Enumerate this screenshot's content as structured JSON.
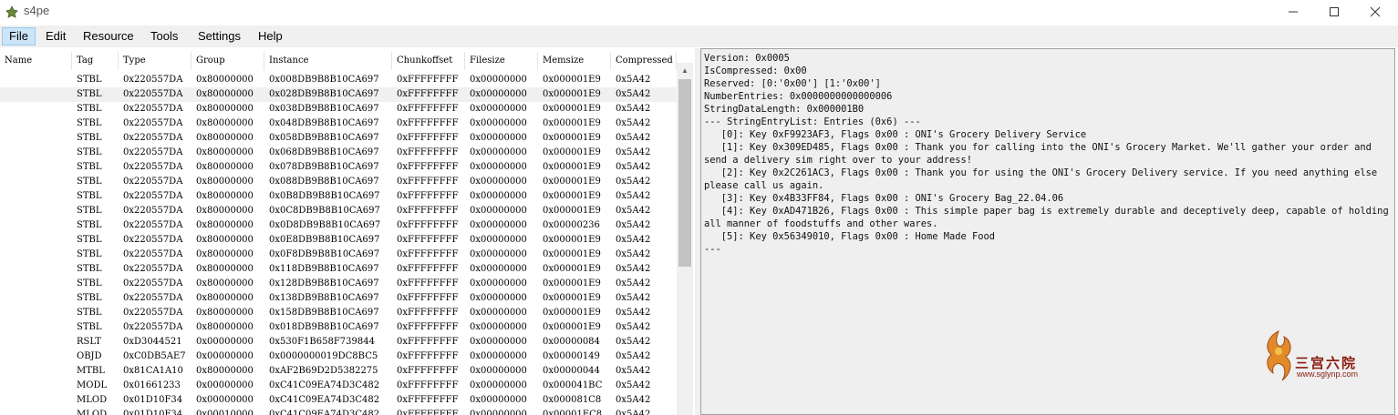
{
  "window": {
    "title": "s4pe"
  },
  "menu": [
    "File",
    "Edit",
    "Resource",
    "Tools",
    "Settings",
    "Help"
  ],
  "columns": [
    "Name",
    "Tag",
    "Type",
    "Group",
    "Instance",
    "Chunkoffset",
    "Filesize",
    "Memsize",
    "Compressed"
  ],
  "rows": [
    [
      "",
      "STBL",
      "0x220557DA",
      "0x80000000",
      "0x008DB9B8B10CA697",
      "0xFFFFFFFF",
      "0x00000000",
      "0x000001E9",
      "0x5A42"
    ],
    [
      "",
      "STBL",
      "0x220557DA",
      "0x80000000",
      "0x028DB9B8B10CA697",
      "0xFFFFFFFF",
      "0x00000000",
      "0x000001E9",
      "0x5A42"
    ],
    [
      "",
      "STBL",
      "0x220557DA",
      "0x80000000",
      "0x038DB9B8B10CA697",
      "0xFFFFFFFF",
      "0x00000000",
      "0x000001E9",
      "0x5A42"
    ],
    [
      "",
      "STBL",
      "0x220557DA",
      "0x80000000",
      "0x048DB9B8B10CA697",
      "0xFFFFFFFF",
      "0x00000000",
      "0x000001E9",
      "0x5A42"
    ],
    [
      "",
      "STBL",
      "0x220557DA",
      "0x80000000",
      "0x058DB9B8B10CA697",
      "0xFFFFFFFF",
      "0x00000000",
      "0x000001E9",
      "0x5A42"
    ],
    [
      "",
      "STBL",
      "0x220557DA",
      "0x80000000",
      "0x068DB9B8B10CA697",
      "0xFFFFFFFF",
      "0x00000000",
      "0x000001E9",
      "0x5A42"
    ],
    [
      "",
      "STBL",
      "0x220557DA",
      "0x80000000",
      "0x078DB9B8B10CA697",
      "0xFFFFFFFF",
      "0x00000000",
      "0x000001E9",
      "0x5A42"
    ],
    [
      "",
      "STBL",
      "0x220557DA",
      "0x80000000",
      "0x088DB9B8B10CA697",
      "0xFFFFFFFF",
      "0x00000000",
      "0x000001E9",
      "0x5A42"
    ],
    [
      "",
      "STBL",
      "0x220557DA",
      "0x80000000",
      "0x0B8DB9B8B10CA697",
      "0xFFFFFFFF",
      "0x00000000",
      "0x000001E9",
      "0x5A42"
    ],
    [
      "",
      "STBL",
      "0x220557DA",
      "0x80000000",
      "0x0C8DB9B8B10CA697",
      "0xFFFFFFFF",
      "0x00000000",
      "0x000001E9",
      "0x5A42"
    ],
    [
      "",
      "STBL",
      "0x220557DA",
      "0x80000000",
      "0x0D8DB9B8B10CA697",
      "0xFFFFFFFF",
      "0x00000000",
      "0x00000236",
      "0x5A42"
    ],
    [
      "",
      "STBL",
      "0x220557DA",
      "0x80000000",
      "0x0E8DB9B8B10CA697",
      "0xFFFFFFFF",
      "0x00000000",
      "0x000001E9",
      "0x5A42"
    ],
    [
      "",
      "STBL",
      "0x220557DA",
      "0x80000000",
      "0x0F8DB9B8B10CA697",
      "0xFFFFFFFF",
      "0x00000000",
      "0x000001E9",
      "0x5A42"
    ],
    [
      "",
      "STBL",
      "0x220557DA",
      "0x80000000",
      "0x118DB9B8B10CA697",
      "0xFFFFFFFF",
      "0x00000000",
      "0x000001E9",
      "0x5A42"
    ],
    [
      "",
      "STBL",
      "0x220557DA",
      "0x80000000",
      "0x128DB9B8B10CA697",
      "0xFFFFFFFF",
      "0x00000000",
      "0x000001E9",
      "0x5A42"
    ],
    [
      "",
      "STBL",
      "0x220557DA",
      "0x80000000",
      "0x138DB9B8B10CA697",
      "0xFFFFFFFF",
      "0x00000000",
      "0x000001E9",
      "0x5A42"
    ],
    [
      "",
      "STBL",
      "0x220557DA",
      "0x80000000",
      "0x158DB9B8B10CA697",
      "0xFFFFFFFF",
      "0x00000000",
      "0x000001E9",
      "0x5A42"
    ],
    [
      "",
      "STBL",
      "0x220557DA",
      "0x80000000",
      "0x018DB9B8B10CA697",
      "0xFFFFFFFF",
      "0x00000000",
      "0x000001E9",
      "0x5A42"
    ],
    [
      "",
      "RSLT",
      "0xD3044521",
      "0x00000000",
      "0x530F1B658F739844",
      "0xFFFFFFFF",
      "0x00000000",
      "0x00000084",
      "0x5A42"
    ],
    [
      "",
      "OBJD",
      "0xC0DB5AE7",
      "0x00000000",
      "0x0000000019DC8BC5",
      "0xFFFFFFFF",
      "0x00000000",
      "0x00000149",
      "0x5A42"
    ],
    [
      "",
      "MTBL",
      "0x81CA1A10",
      "0x80000000",
      "0xAF2B69D2D5382275",
      "0xFFFFFFFF",
      "0x00000000",
      "0x00000044",
      "0x5A42"
    ],
    [
      "",
      "MODL",
      "0x01661233",
      "0x00000000",
      "0xC41C09EA74D3C482",
      "0xFFFFFFFF",
      "0x00000000",
      "0x000041BC",
      "0x5A42"
    ],
    [
      "",
      "MLOD",
      "0x01D10F34",
      "0x00000000",
      "0xC41C09EA74D3C482",
      "0xFFFFFFFF",
      "0x00000000",
      "0x000081C8",
      "0x5A42"
    ],
    [
      "",
      "MLOD",
      "0x01D10F34",
      "0x00010000",
      "0xC41C09EA74D3C482",
      "0xFFFFFFFF",
      "0x00000000",
      "0x00001EC8",
      "0x5A42"
    ]
  ],
  "selected_row_index": 1,
  "detail_text": "Version: 0x0005\nIsCompressed: 0x00\nReserved: [0:'0x00'] [1:'0x00']\nNumberEntries: 0x0000000000000006\nStringDataLength: 0x000001B0\n--- StringEntryList: Entries (0x6) ---\n   [0]: Key 0xF9923AF3, Flags 0x00 : ONI's Grocery Delivery Service\n   [1]: Key 0x309ED485, Flags 0x00 : Thank you for calling into the ONI's Grocery Market. We'll gather your order and send a delivery sim right over to your address!\n   [2]: Key 0x2C261AC3, Flags 0x00 : Thank you for using the ONI's Grocery Delivery service. If you need anything else please call us again.\n   [3]: Key 0x4B33FF84, Flags 0x00 : ONI's Grocery Bag_22.04.06\n   [4]: Key 0xAD471B26, Flags 0x00 : This simple paper bag is extremely durable and deceptively deep, capable of holding all manner of foodstuffs and other wares.\n   [5]: Key 0x56349010, Flags 0x00 : Home Made Food\n---",
  "watermark": {
    "cn": "三宫六院",
    "url": "www.sglynp.com"
  },
  "colors": {
    "menu_active_bg": "#cce4f7",
    "selected_row_bg": "#f0f0f0",
    "detail_bg": "#efefef",
    "watermark": "#8a1a10"
  }
}
